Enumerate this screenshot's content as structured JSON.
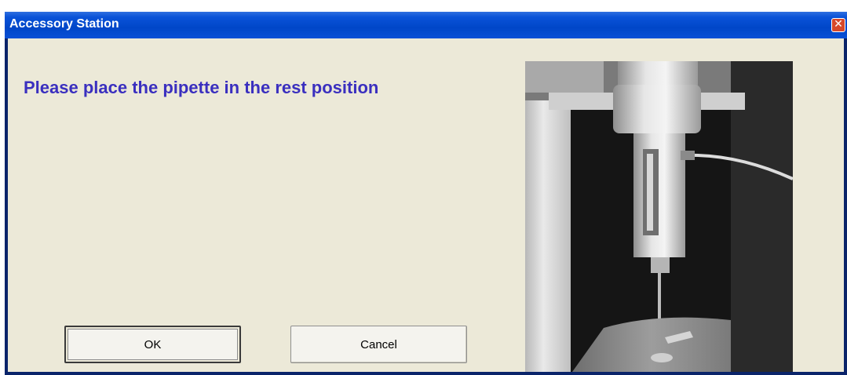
{
  "window": {
    "title": "Accessory Station"
  },
  "dialog": {
    "message": "Please place the pipette in the rest position",
    "ok_label": "OK",
    "cancel_label": "Cancel"
  },
  "icons": {
    "close": "close-icon",
    "photo": "pipette-photo"
  },
  "colors": {
    "title_bar": "#0046c8",
    "client_bg": "#ece9d8",
    "message_text": "#3a2fbf",
    "close_button": "#d7482a"
  }
}
